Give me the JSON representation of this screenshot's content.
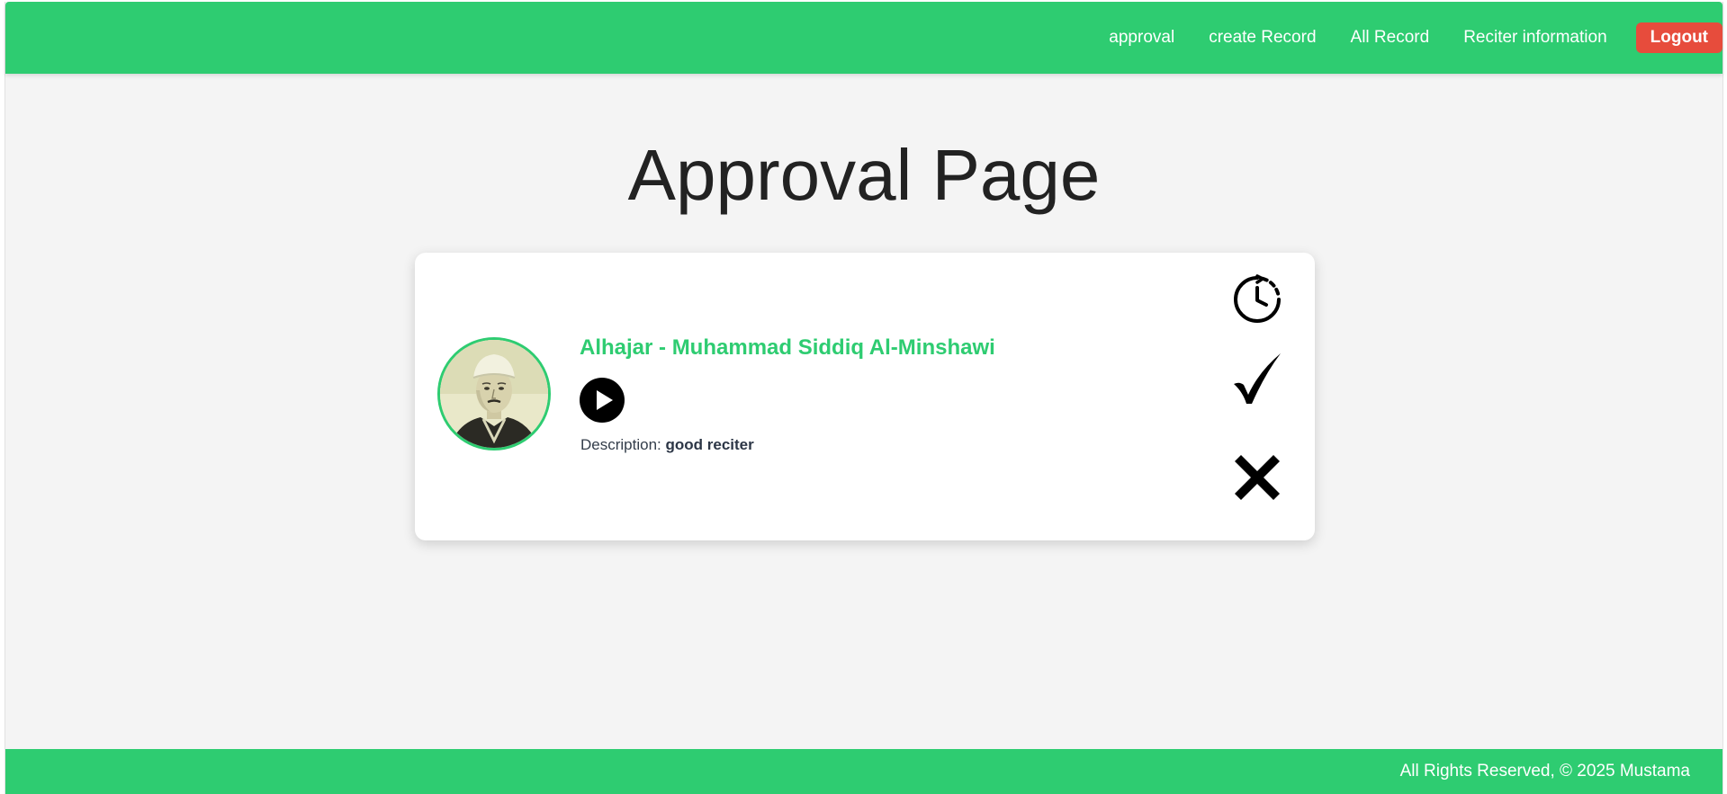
{
  "nav": {
    "links": [
      "approval",
      "create Record",
      "All Record",
      "Reciter information"
    ],
    "logout_label": "Logout"
  },
  "page": {
    "title": "Approval Page"
  },
  "record": {
    "title": "Alhajar - Muhammad Siddiq Al-Minshawi",
    "description_label": "Description:",
    "description_value": "good reciter",
    "avatar_icon": "reciter-portrait",
    "play_icon": "play-icon"
  },
  "actions": {
    "pending_icon": "clock-pending-icon",
    "approve_icon": "checkmark-icon",
    "reject_icon": "x-icon"
  },
  "footer": {
    "text": "All Rights Reserved, © 2025 Mustama"
  },
  "colors": {
    "brand_green": "#2ecc71",
    "logout_red": "#e74c3c",
    "background": "#f4f4f4"
  }
}
